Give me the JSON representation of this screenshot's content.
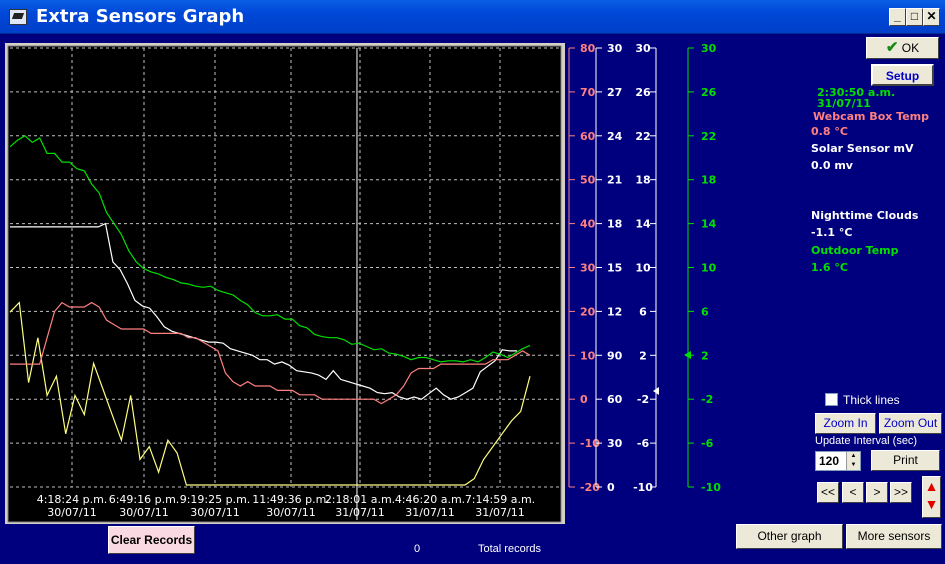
{
  "window": {
    "title": "Extra Sensors Graph",
    "minimize": "_",
    "maximize": "□",
    "close": "✕"
  },
  "chart_data": {
    "type": "line",
    "x_labels": [
      [
        "4:18:24 p.m.",
        "30/07/11"
      ],
      [
        "6:49:16 p.m.",
        "30/07/11"
      ],
      [
        "9:19:25 p.m.",
        "30/07/11"
      ],
      [
        "11:49:36 p.m.",
        "30/07/11"
      ],
      [
        "2:18:01 a.m.",
        "31/07/11"
      ],
      [
        "4:46:20 a.m.",
        "31/07/11"
      ],
      [
        "7:14:59 a.m.",
        "31/07/11"
      ]
    ],
    "axes": [
      {
        "name": "pink",
        "color": "#ff8080",
        "ticks": [
          "80",
          "70",
          "60",
          "50",
          "40",
          "30",
          "20",
          "10",
          "0",
          "-10",
          "-20"
        ],
        "range": [
          -20,
          80
        ]
      },
      {
        "name": "white",
        "color": "#ffffff",
        "ticks": [
          "30",
          "27",
          "24",
          "21",
          "18",
          "15",
          "12",
          "90",
          "60",
          "30",
          "0"
        ]
      },
      {
        "name": "white-2",
        "color": "#ffffff",
        "ticks": [
          "30",
          "26",
          "22",
          "18",
          "14",
          "10",
          "6",
          "2",
          "-2",
          "-6",
          "-10"
        ],
        "range": [
          -10,
          30
        ]
      },
      {
        "name": "green",
        "color": "#00e000",
        "ticks": [
          "30",
          "26",
          "22",
          "18",
          "14",
          "10",
          "6",
          "2",
          "-2",
          "-6",
          "-10"
        ],
        "range": [
          -10,
          30
        ]
      }
    ],
    "series": [
      {
        "color": "#ffff80",
        "values": [
          54,
          57,
          32,
          46,
          28,
          34,
          16,
          28,
          22,
          38,
          30,
          22,
          14,
          28,
          8,
          12,
          4,
          14,
          10,
          0,
          0,
          0,
          0,
          0,
          0,
          0,
          0,
          0,
          0,
          0,
          0,
          0,
          0,
          0,
          0,
          0,
          0,
          0,
          0,
          0,
          0,
          0,
          0,
          0,
          0,
          0,
          0,
          0,
          0,
          0,
          2,
          8,
          12,
          16,
          20,
          23,
          34
        ]
      },
      {
        "color": "#ffffff",
        "values": [
          13.7,
          13.7,
          13.7,
          13.7,
          13.7,
          13.7,
          13.7,
          13.7,
          13.7,
          13.7,
          13.7,
          13.7,
          13.7,
          14.0,
          10.5,
          9.8,
          8.5,
          7.0,
          6.5,
          6.3,
          5.5,
          4.6,
          4.2,
          4.0,
          3.8,
          3.6,
          3.4,
          3.2,
          3.2,
          3.1,
          2.6,
          2.4,
          2.2,
          2.0,
          1.6,
          1.6,
          1.2,
          1.4,
          1.1,
          0.6,
          0.5,
          0.4,
          0.2,
          -0.2,
          0.6,
          -0.2,
          -0.4,
          -0.6,
          -0.8,
          -1.0,
          -1.4,
          -1.5,
          -1.4,
          -1.8,
          -2.0,
          -1.8,
          -2.0,
          -1.5,
          -1.0,
          -1.6,
          -2.0,
          -1.8,
          -1.4,
          -1.0,
          0.5,
          1.0,
          1.5,
          2.5,
          2.4,
          2.4
        ]
      },
      {
        "color": "#ff8080",
        "values": [
          8,
          8,
          8,
          8,
          8,
          14,
          20,
          22,
          21,
          21,
          21,
          22,
          21,
          18,
          17,
          16,
          16,
          16,
          16,
          15,
          15,
          15,
          15,
          15,
          14,
          14,
          13,
          12,
          11,
          6,
          4,
          3,
          4,
          3,
          3,
          3,
          2,
          2,
          2,
          1,
          1,
          1,
          0,
          0,
          0,
          0,
          0,
          0,
          0,
          0,
          -1,
          0,
          1,
          3,
          6,
          7,
          7,
          7,
          8,
          8,
          8,
          8,
          8,
          8,
          8,
          9,
          9,
          9,
          10,
          11,
          10
        ]
      },
      {
        "color": "#00e000",
        "values": [
          21.0,
          21.6,
          22.0,
          21.4,
          21.8,
          20.4,
          20.4,
          19.6,
          19.6,
          19.0,
          18.8,
          17.6,
          16.8,
          15.0,
          14.0,
          13.0,
          11.5,
          10.5,
          9.9,
          9.6,
          9.4,
          9.1,
          8.9,
          8.6,
          8.5,
          8.3,
          8.2,
          8.3,
          7.9,
          7.7,
          7.5,
          7.0,
          6.6,
          5.9,
          5.6,
          5.6,
          5.7,
          5.3,
          5.3,
          4.7,
          4.5,
          3.9,
          3.7,
          3.6,
          3.6,
          3.4,
          3.0,
          3.1,
          2.8,
          2.5,
          2.6,
          2.2,
          2.1,
          1.9,
          1.6,
          1.8,
          1.8,
          1.6,
          1.4,
          1.5,
          1.5,
          1.4,
          1.6,
          1.4,
          1.8,
          2.3,
          2.1,
          1.8,
          2.2,
          2.6,
          2.9
        ]
      }
    ],
    "cursor_x_index": 0.632
  },
  "buttons": {
    "ok": "OK",
    "setup": "Setup",
    "zoom_in": "Zoom In",
    "zoom_out": "Zoom Out",
    "print": "Print",
    "nav_first": "<<",
    "nav_prev": "<",
    "nav_next": ">",
    "nav_last": ">>",
    "clear_records": "Clear Records",
    "other_graph": "Other graph",
    "more_sensors": "More sensors"
  },
  "readout": {
    "time": "2:30:50 a.m.",
    "date": "31/07/11",
    "sensor1_name": "Webcam Box Temp",
    "sensor1_value": "0.8 °C",
    "sensor2_name": "Solar Sensor mV",
    "sensor2_value": "0.0 mv",
    "sensor3_name": "Nighttime Clouds",
    "sensor3_value": "-1.1 °C",
    "sensor4_name": "Outdoor Temp",
    "sensor4_value": "1.6 °C"
  },
  "colors": {
    "time": "#00e000",
    "sensor1": "#ff8080",
    "sensor2": "#ffffff",
    "sensor3": "#ffffff",
    "sensor4": "#00e000"
  },
  "options": {
    "thick_lines_label": "Thick lines",
    "update_interval_label": "Update Interval (sec)",
    "update_interval": "120"
  },
  "footer": {
    "record_count": "0",
    "total_records_label": "Total records"
  }
}
